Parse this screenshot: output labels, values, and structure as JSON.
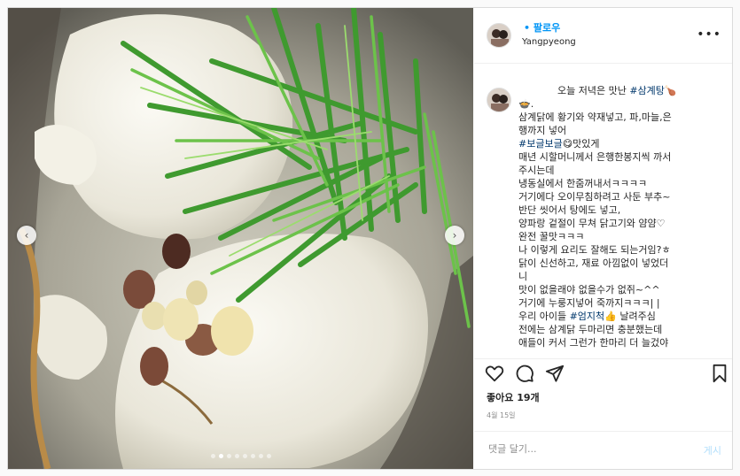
{
  "post": {
    "username": "",
    "follow_label": "• 팔로우",
    "location": "Yangpyeong",
    "more_icon": "more-dots-icon"
  },
  "caption": {
    "lines": [
      "오늘 저녁은 맛난 ",
      ".",
      "삼계닭에 황기와 약재넣고, 파,마늘,은",
      "행까지 넣어",
      "맛있게",
      "매년 시할머니께서 은행한봉지씩 까서",
      "주시는데",
      "냉동실에서 한줌꺼내서ㅋㅋㅋㅋ",
      "거기에다 오이무침하려고 사둔 부추~",
      "반단 씻어서 탕에도 넣고,",
      "양파랑 겉절이 무쳐 닭고기와 얌얌♡",
      "완전 꿀맛ㅋㅋㅋ",
      "나 이렇게 요리도 잘해도 되는거임?ㅎ",
      "닭이 신선하고, 재료 아낌없이 넣었더",
      "니",
      "맛이 없을래야 없을수가 없쥐~^^",
      "거기에 누룽지넣어 죽까지ㅋㅋㅋ| |",
      "우리 아이들 ",
      " 날려주심",
      "전에는 삼계닭 두마리면 충분했는데",
      "애들이 커서 그런가 한마리 더 늘겄야"
    ],
    "hashtag_samgyetang": "#삼계탕",
    "hashtag_bogeul": "#보글보글",
    "hashtag_eomji": "#엄지척",
    "emoji_drumstick": "🍗",
    "emoji_bowl": "🍲",
    "emoji_yum": "😋",
    "emoji_thumb": "👍"
  },
  "engagement": {
    "likes_label": "좋아요 19개",
    "date": "4월 15일"
  },
  "comment": {
    "placeholder": "댓글 달기...",
    "post_label": "게시"
  },
  "carousel": {
    "prev_glyph": "‹",
    "next_glyph": "›",
    "slide_count": 8,
    "active_index": 1
  },
  "colors": {
    "link_blue": "#0095f6",
    "hashtag": "#00376b",
    "muted": "#8e8e8e"
  }
}
